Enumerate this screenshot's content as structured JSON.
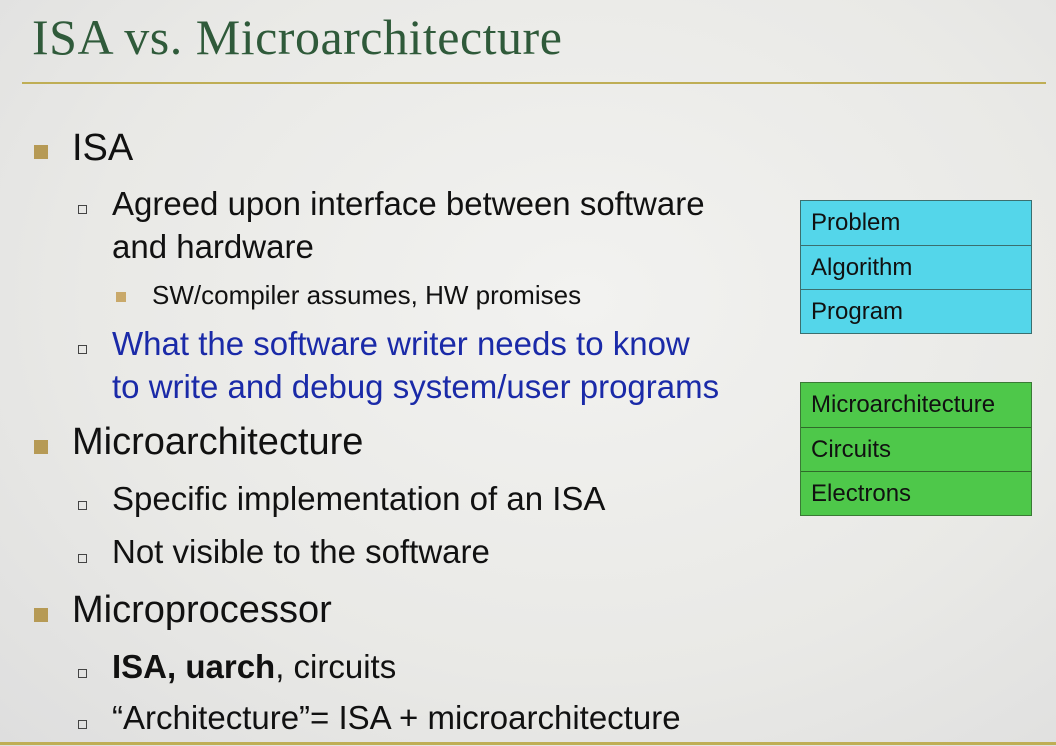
{
  "slide": {
    "title": "ISA vs. Microarchitecture",
    "isa": {
      "heading": "ISA",
      "point1_line1": "Agreed upon interface between software",
      "point1_line2": "and hardware",
      "sub1": "SW/compiler assumes, HW promises",
      "point2_line1": "What the software writer needs to know",
      "point2_line2": "to write and debug system/user programs"
    },
    "microarch": {
      "heading": "Microarchitecture",
      "point1": "Specific implementation of an ISA",
      "point2": "Not visible to the software"
    },
    "microprocessor": {
      "heading": "Microprocessor",
      "point1_bold": "ISA, uarch",
      "point1_rest": ", circuits",
      "point2": "“Architecture”= ISA + microarchitecture"
    },
    "stack_top": [
      "Problem",
      "Algorithm",
      "Program"
    ],
    "stack_bottom": [
      "Microarchitecture",
      "Circuits",
      "Electrons"
    ]
  }
}
